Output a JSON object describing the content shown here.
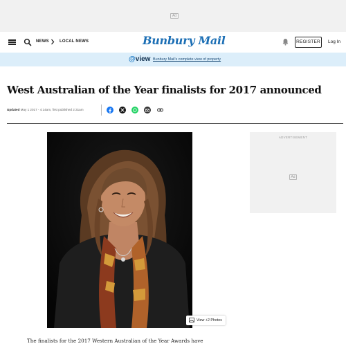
{
  "top_ad": {
    "chip": "Ad"
  },
  "header": {
    "nav": [
      "NEWS",
      "LOCAL NEWS"
    ],
    "logo": "Bunbury Mail",
    "register_label": "REGISTER",
    "login_label": "Log In",
    "icons": [
      "menu-icon",
      "search-icon",
      "chevron-right-icon",
      "bell-icon"
    ]
  },
  "promo": {
    "brand": "view",
    "link_text": "Bunbury Mail's complete view of property",
    "background": "#dceefa"
  },
  "article": {
    "headline": "West Australian of the Year finalists for 2017 announced",
    "updated_label": "Updated",
    "updated_text": " May 1 2017 - 4:14am, first published 2:31am",
    "share_icons": [
      "facebook-icon",
      "x-icon",
      "whatsapp-icon",
      "email-icon",
      "link-icon"
    ],
    "photo_button": "View +2 Photos",
    "body_first_line": "The finalists for the 2017 Western Australian of the Year Awards have"
  },
  "side_ad": {
    "label": "ADVERTISEMENT",
    "chip": "Ad"
  },
  "colors": {
    "brand": "#1c6fb5",
    "facebook": "#1877f2",
    "whatsapp": "#25d366",
    "dark": "#222222"
  }
}
